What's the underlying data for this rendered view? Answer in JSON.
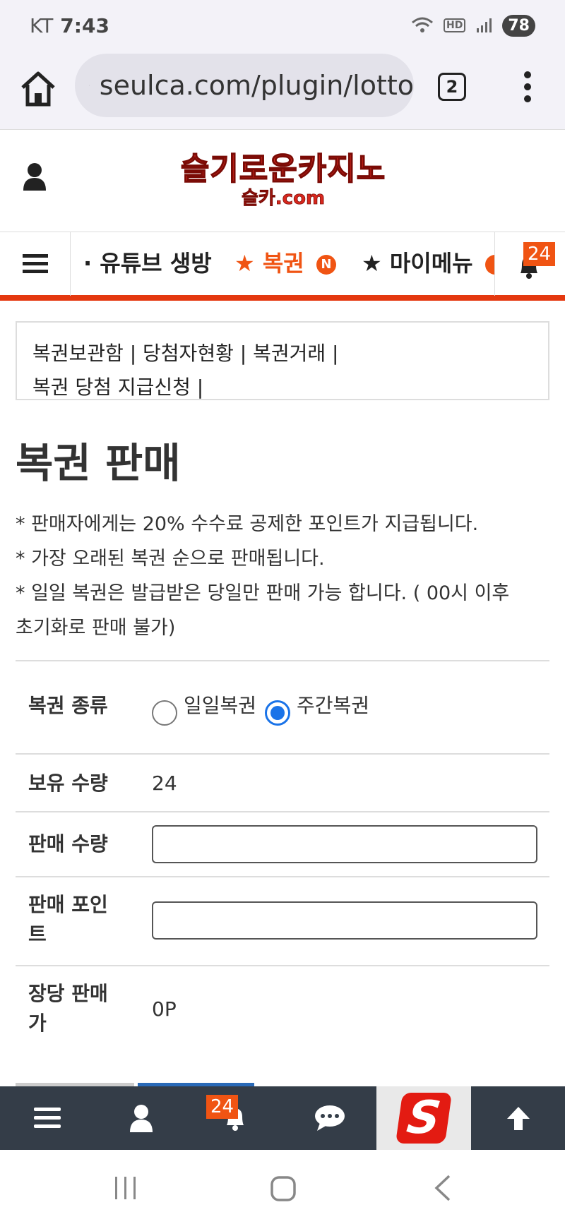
{
  "status_bar": {
    "carrier": "KT",
    "time": "7:43",
    "battery": "78"
  },
  "browser": {
    "url": "seulca.com/plugin/lotto",
    "tab_count": "2"
  },
  "site": {
    "logo_main": "슬기로운카지노",
    "logo_sub": "슬카.com"
  },
  "nav": {
    "items": [
      {
        "label": "· 유튜브 생방",
        "color": "#222222"
      },
      {
        "label": "★ 복권",
        "color": "#f05413",
        "new_badge": "N"
      },
      {
        "label": "★ 마이메뉴",
        "color": "#222222"
      }
    ],
    "bell_badge": "24"
  },
  "lottery_links": {
    "line1": "복권보관함 | 당첨자현황 | 복권거래 |",
    "line2": "복권 당첨 지급신청 |"
  },
  "page": {
    "title": "복권 판매",
    "notices": [
      "* 판매자에게는 20% 수수료 공제한 포인트가 지급됩니다.",
      "* 가장 오래된 복권 순으로 판매됩니다.",
      "* 일일 복권은 발급받은 당일만 판매 가능 합니다. ( 00시 이후",
      "초기화로 판매 불가)"
    ]
  },
  "form": {
    "type_label": "복권 종류",
    "type_options": [
      "일일복권",
      "주간복권"
    ],
    "type_selected": "주간복권",
    "holding_label": "보유 수량",
    "holding_value": "24",
    "sell_qty_label": "판매 수량",
    "sell_qty_value": "",
    "sell_point_label_1": "판매 포인",
    "sell_point_label_2": "트",
    "sell_point_value": "",
    "unit_price_label_1": "장당 판매",
    "unit_price_label_2": "가",
    "unit_price_value": "0P"
  },
  "bottom_nav": {
    "bell_badge": "24",
    "logo_letter": "S"
  },
  "colors": {
    "accent": "#f05413",
    "nav_underline": "#e4380f",
    "bottom_bar": "#343d48",
    "radio_checked": "#1a73e8",
    "logo_red": "#d8281e"
  }
}
